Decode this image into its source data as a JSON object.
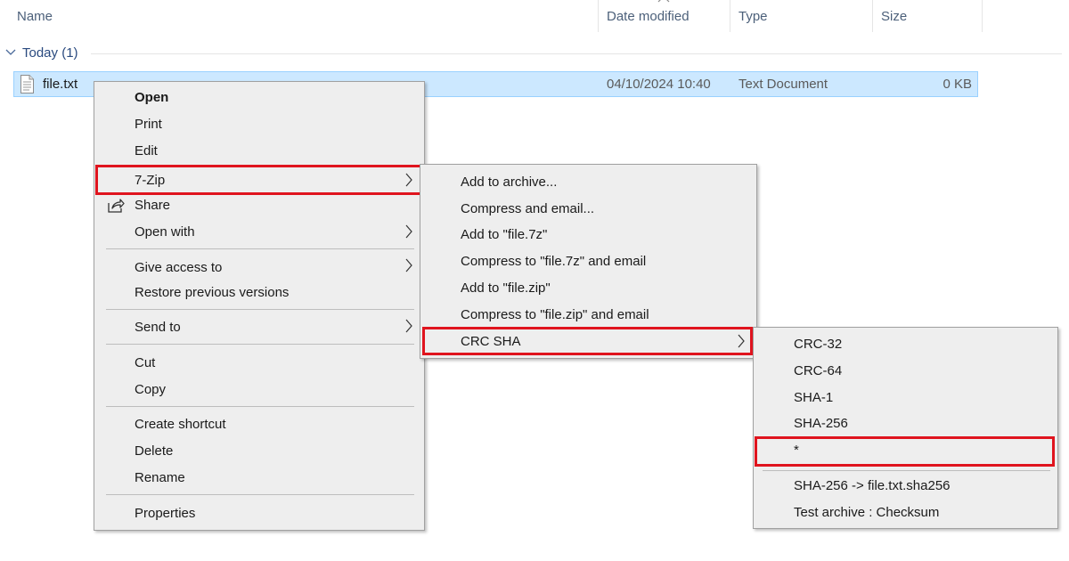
{
  "columns": {
    "name": "Name",
    "date_modified": "Date modified",
    "type": "Type",
    "size": "Size"
  },
  "group": {
    "label": "Today (1)"
  },
  "file": {
    "name": "file.txt",
    "date": "04/10/2024 10:40",
    "type": "Text Document",
    "size": "0 KB",
    "icon": "text-file-icon"
  },
  "context_menu": {
    "items": [
      {
        "label": "Open"
      },
      {
        "label": "Print"
      },
      {
        "label": "Edit"
      },
      {
        "label": "7-Zip"
      },
      {
        "label": "Share",
        "icon": "share-icon"
      },
      {
        "label": "Open with"
      },
      {
        "label": "Give access to"
      },
      {
        "label": "Restore previous versions"
      },
      {
        "label": "Send to"
      },
      {
        "label": "Cut"
      },
      {
        "label": "Copy"
      },
      {
        "label": "Create shortcut"
      },
      {
        "label": "Delete"
      },
      {
        "label": "Rename"
      },
      {
        "label": "Properties"
      }
    ]
  },
  "zip_menu": {
    "items": [
      {
        "label": "Add to archive..."
      },
      {
        "label": "Compress and email..."
      },
      {
        "label": "Add to \"file.7z\""
      },
      {
        "label": "Compress to \"file.7z\" and email"
      },
      {
        "label": "Add to \"file.zip\""
      },
      {
        "label": "Compress to \"file.zip\" and email"
      },
      {
        "label": "CRC SHA"
      }
    ]
  },
  "crc_menu": {
    "items": [
      {
        "label": "CRC-32"
      },
      {
        "label": "CRC-64"
      },
      {
        "label": "SHA-1"
      },
      {
        "label": "SHA-256"
      },
      {
        "label": "*"
      },
      {
        "label": "SHA-256 -> file.txt.sha256"
      },
      {
        "label": "Test archive : Checksum"
      }
    ]
  },
  "colors": {
    "selection": "#cce8ff",
    "highlight_border": "#e0141e",
    "menu_bg": "#eeeeee"
  }
}
